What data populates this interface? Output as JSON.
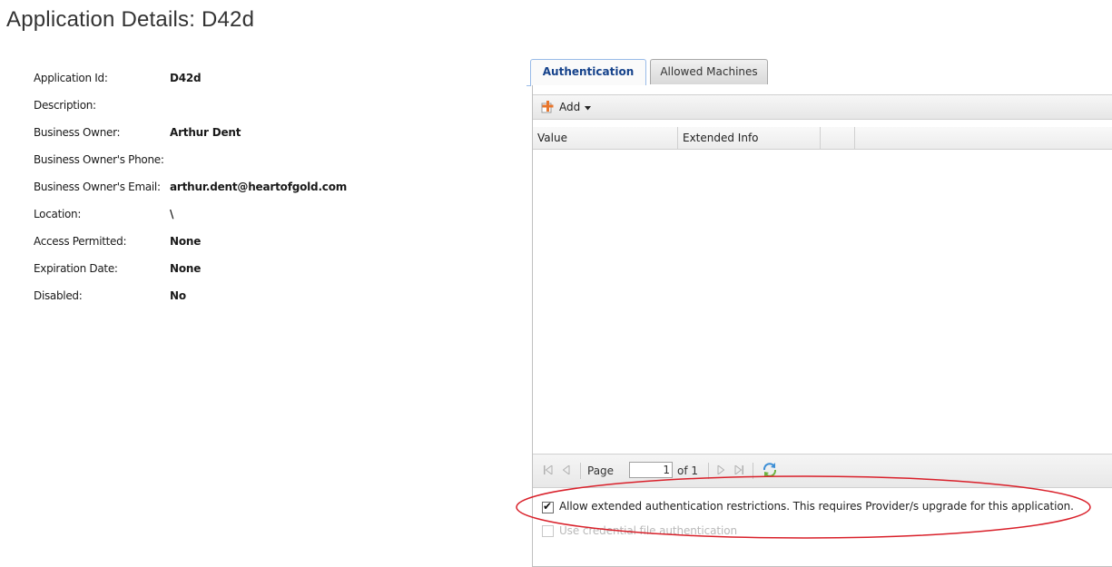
{
  "page": {
    "title": "Application Details: D42d"
  },
  "details": [
    {
      "label": "Application Id:",
      "value": "D42d"
    },
    {
      "label": "Description:",
      "value": ""
    },
    {
      "label": "Business Owner:",
      "value": "Arthur Dent"
    },
    {
      "label": "Business Owner's Phone:",
      "value": ""
    },
    {
      "label": "Business Owner's Email:",
      "value": "arthur.dent@heartofgold.com"
    },
    {
      "label": "Location:",
      "value": "\\"
    },
    {
      "label": "Access Permitted:",
      "value": "None"
    },
    {
      "label": "Expiration Date:",
      "value": "None"
    },
    {
      "label": "Disabled:",
      "value": "No"
    }
  ],
  "tabs": [
    {
      "label": "Authentication",
      "active": true
    },
    {
      "label": "Allowed Machines",
      "active": false
    }
  ],
  "toolbar": {
    "add_label": "Add",
    "add_icon": "add-plus-icon",
    "dropdown_icon": "caret-down-icon"
  },
  "grid": {
    "columns": [
      "Value",
      "Extended Info",
      ""
    ]
  },
  "pager": {
    "page_label": "Page",
    "page_value": "1",
    "of_label": "of 1"
  },
  "options": {
    "extended_auth": {
      "label": "Allow extended authentication restrictions. This requires Provider/s upgrade for this application.",
      "checked": true
    },
    "credential_file": {
      "label": "Use credential file authentication",
      "checked": false,
      "disabled": true
    }
  },
  "colors": {
    "tab_active_text": "#15428b",
    "highlight": "#d9202a",
    "add_icon": "#e8762d"
  }
}
